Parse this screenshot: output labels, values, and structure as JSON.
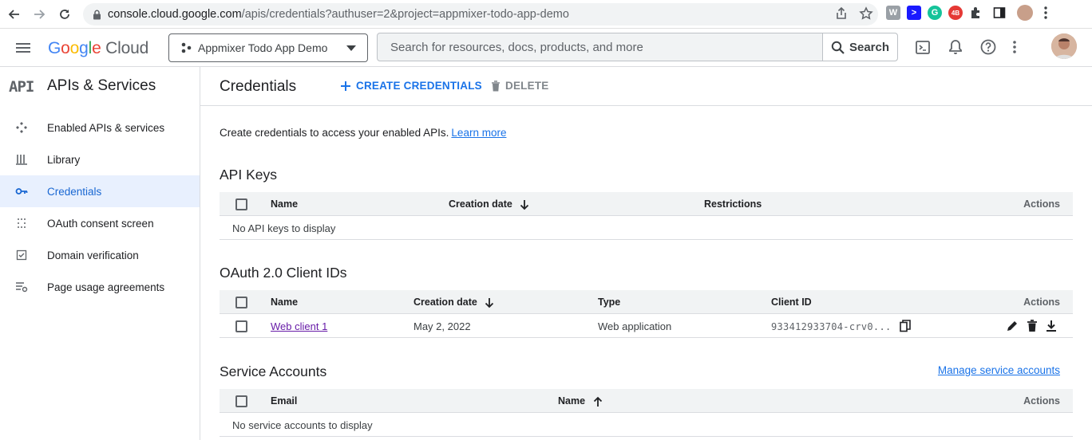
{
  "browser": {
    "url_host": "console.cloud.google.com",
    "url_path": "/apis/credentials?authuser=2&project=appmixer-todo-app-demo"
  },
  "header": {
    "logo_google": "Google",
    "logo_cloud": " Cloud",
    "project_name": "Appmixer Todo App Demo",
    "search_placeholder": "Search for resources, docs, products, and more",
    "search_button": "Search"
  },
  "sidebar": {
    "logo": "API",
    "title": "APIs & Services",
    "items": [
      {
        "label": "Enabled APIs & services",
        "icon": "enabled-apis-icon",
        "active": false
      },
      {
        "label": "Library",
        "icon": "library-icon",
        "active": false
      },
      {
        "label": "Credentials",
        "icon": "key-icon",
        "active": true
      },
      {
        "label": "OAuth consent screen",
        "icon": "consent-screen-icon",
        "active": false
      },
      {
        "label": "Domain verification",
        "icon": "domain-verification-icon",
        "active": false
      },
      {
        "label": "Page usage agreements",
        "icon": "page-usage-icon",
        "active": false
      }
    ]
  },
  "main": {
    "title": "Credentials",
    "create_label": "CREATE CREDENTIALS",
    "delete_label": "DELETE",
    "intro_text": "Create credentials to access your enabled APIs.",
    "learn_more": "Learn more",
    "api_keys": {
      "title": "API Keys",
      "columns": [
        "Name",
        "Creation date",
        "Restrictions",
        "Actions"
      ],
      "empty": "No API keys to display"
    },
    "oauth": {
      "title": "OAuth 2.0 Client IDs",
      "columns": [
        "Name",
        "Creation date",
        "Type",
        "Client ID",
        "Actions"
      ],
      "rows": [
        {
          "name": "Web client 1",
          "date": "May 2, 2022",
          "type": "Web application",
          "client_id": "933412933704-crv0..."
        }
      ]
    },
    "service_accounts": {
      "title": "Service Accounts",
      "manage_link": "Manage service accounts",
      "columns": [
        "Email",
        "Name",
        "Actions"
      ],
      "empty": "No service accounts to display"
    }
  }
}
